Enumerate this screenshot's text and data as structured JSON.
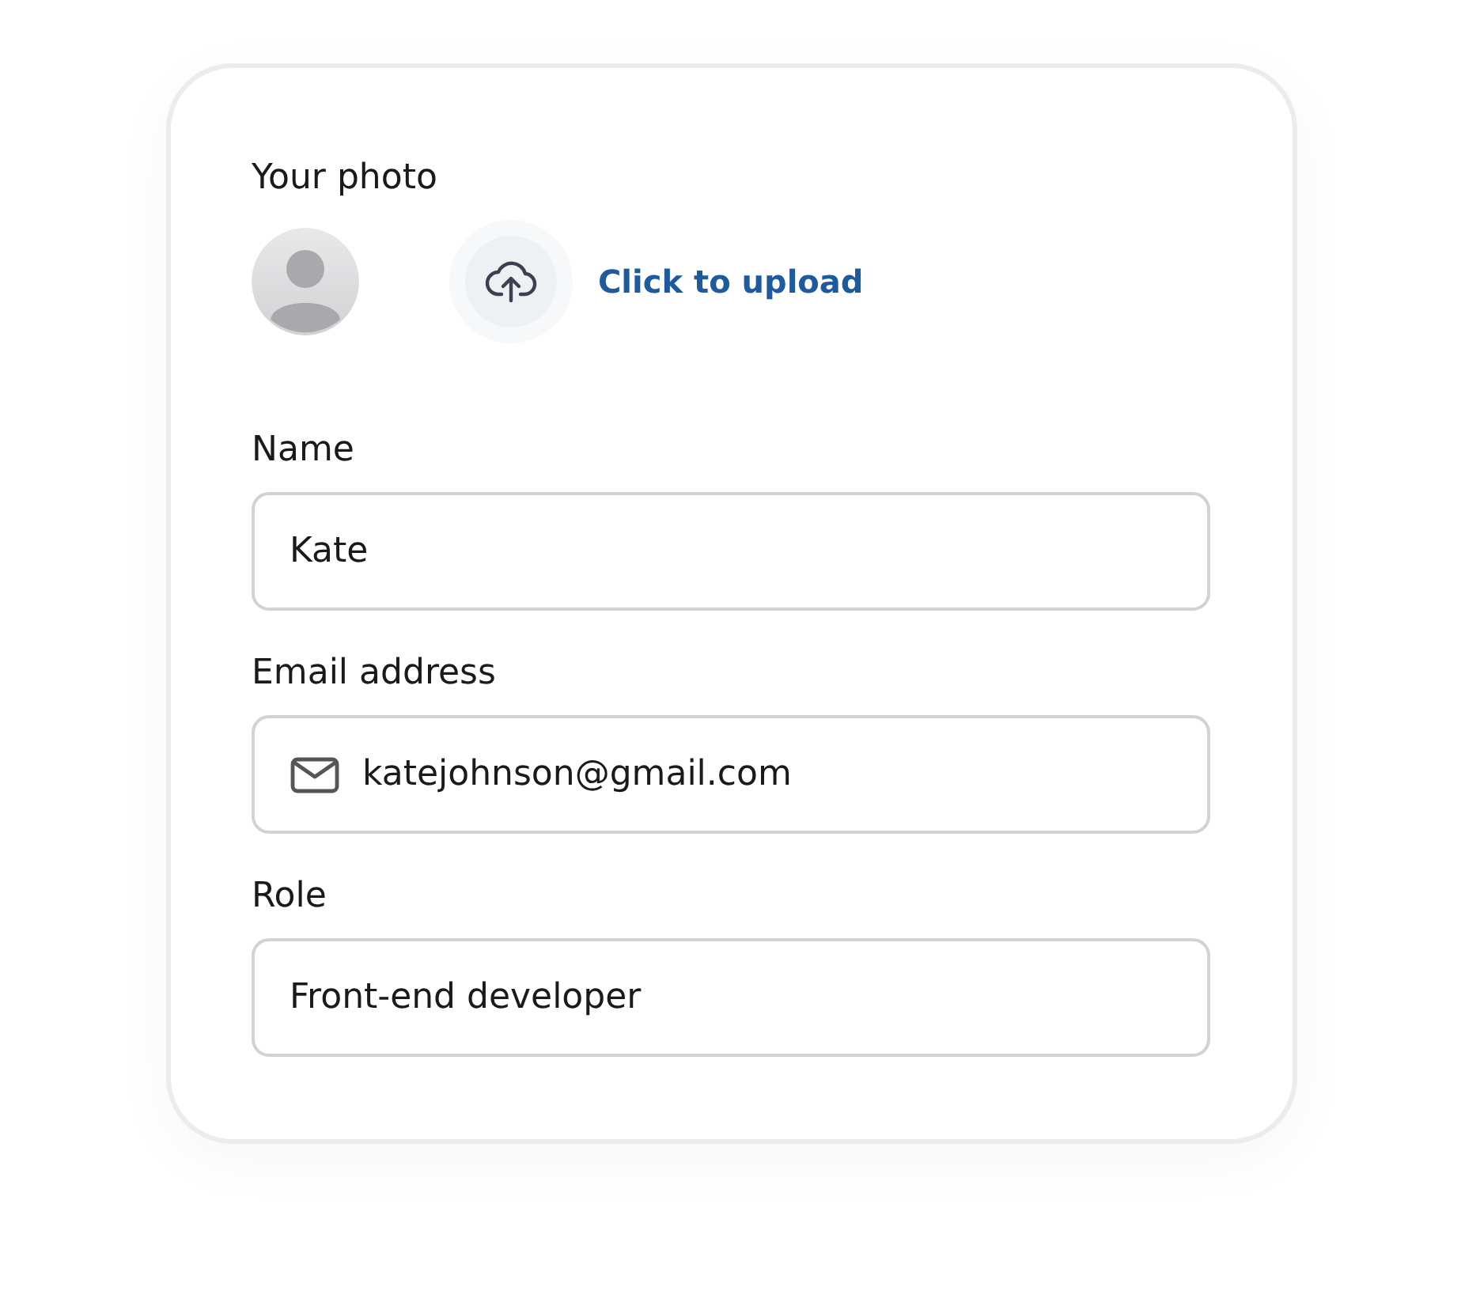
{
  "photo_section": {
    "label": "Your photo",
    "upload_link": "Click to upload"
  },
  "fields": [
    {
      "label": "Name",
      "value": "Kate",
      "kind": "text"
    },
    {
      "label": "Email address",
      "value": "katejohnson@gmail.com",
      "kind": "email"
    },
    {
      "label": "Role",
      "value": "Front-end developer",
      "kind": "text"
    }
  ]
}
